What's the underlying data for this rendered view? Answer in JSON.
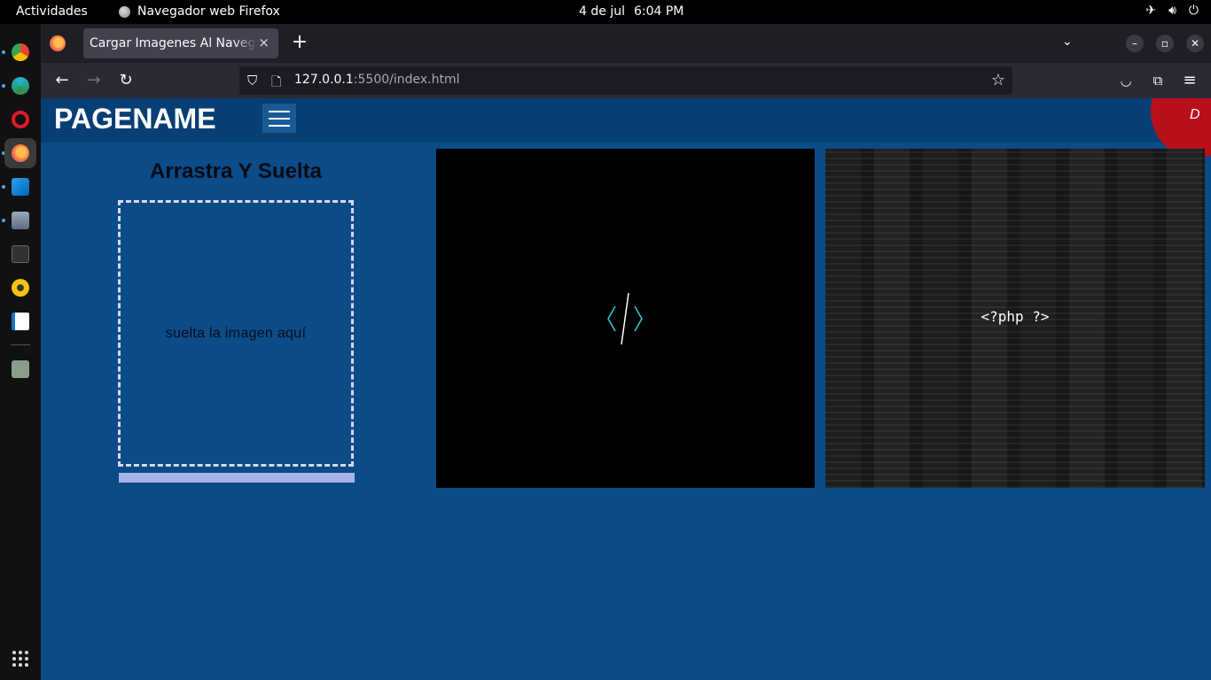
{
  "system": {
    "activities": "Actividades",
    "app_name": "Navegador web Firefox",
    "date": "4 de jul",
    "time": "6:04 PM",
    "tray_icons": [
      "airplane-icon",
      "volume-icon",
      "power-icon"
    ]
  },
  "dock": {
    "items": [
      "chrome-icon",
      "edge-dev-icon",
      "opera-icon",
      "firefox-icon",
      "vscode-icon",
      "files-icon",
      "terminal-icon",
      "rhythmbox-icon",
      "writer-icon",
      "trash-icon"
    ],
    "apps_grid": "show-apps-icon"
  },
  "browser": {
    "tab_title": "Cargar Imagenes Al Navegador",
    "tab_close": "×",
    "new_tab": "+",
    "url_host": "127.0.0.1",
    "url_rest": ":5500/index.html"
  },
  "page": {
    "brand": "PAGENAME",
    "avatar_letter": "D",
    "drop_title": "Arrastra Y Suelta",
    "drop_hint": "suelta la imagen aquí",
    "card2_text": "<?php ?>",
    "colors": {
      "background": "#0a4b88",
      "header": "#073f74",
      "avatar": "#b8101b",
      "progress": "#a8b2e8",
      "code_icon": "#35c9d8"
    }
  }
}
